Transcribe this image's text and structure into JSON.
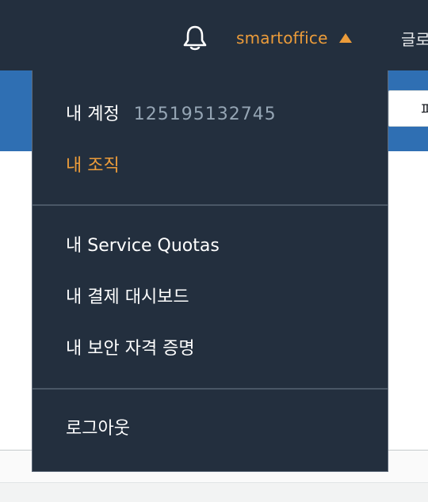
{
  "topbar": {
    "notifications_icon": "bell-icon",
    "account_name": "smartoffice",
    "caret_icon": "caret-up-icon",
    "global_label": "글로벌"
  },
  "background": {
    "button_label": "피드백"
  },
  "account_menu": {
    "my_account_label": "내 계정",
    "account_id": "125195132745",
    "my_organization": "내 조직",
    "service_quotas": "내 Service Quotas",
    "billing_dashboard": "내 결제 대시보드",
    "security_credentials": "내 보안 자격 증명",
    "sign_out": "로그아웃"
  },
  "colors": {
    "nav_bg": "#232f3e",
    "accent_orange": "#ec9c3a",
    "banner_blue": "#2f6fb3",
    "account_id_gray": "#95a5b4"
  }
}
